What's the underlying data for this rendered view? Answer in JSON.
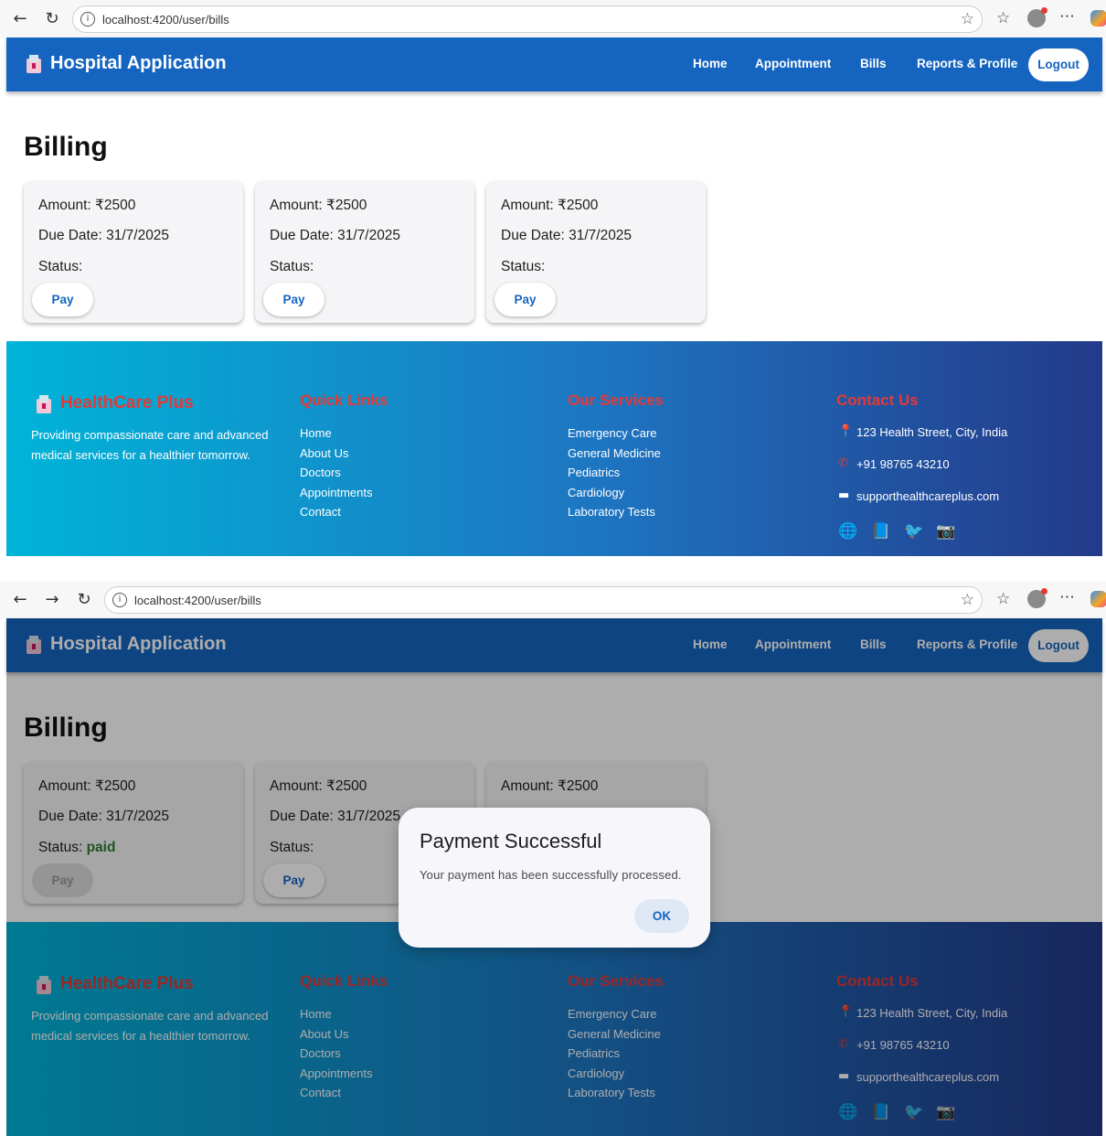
{
  "browser": {
    "url": "localhost:4200/user/bills",
    "icons": [
      "back-icon",
      "forward-icon",
      "refresh-icon",
      "info-icon",
      "star-icon",
      "favorites-icon",
      "profile-icon",
      "more-icon",
      "copilot-icon"
    ]
  },
  "header": {
    "title": "Hospital Application",
    "nav": [
      "Home",
      "Appointment",
      "Bills",
      "Reports & Profile"
    ],
    "logout": "Logout",
    "color": "#1565c0"
  },
  "billing": {
    "title": "Billing",
    "amount_label": "Amount: ₹2500",
    "due_label": "Due Date: 31/7/2025",
    "status_label": "Status:",
    "pay_label": "Pay",
    "paid_text": "paid"
  },
  "footer": {
    "brand": "HealthCare Plus",
    "description": "Providing compassionate care and advanced medical services for a healthier tomorrow.",
    "quick_links_title": "Quick Links",
    "quick_links": [
      "Home",
      "About Us",
      "Doctors",
      "Appointments",
      "Contact"
    ],
    "services_title": "Our Services",
    "services": [
      "Emergency Care",
      "General Medicine",
      "Pediatrics",
      "Cardiology",
      "Laboratory Tests"
    ],
    "contact_title": "Contact Us",
    "address": "123 Health Street, City, India",
    "phone": "+91 98765 43210",
    "email": "supporthealthcareplus.com",
    "social_icons": [
      "globe-icon",
      "book-icon",
      "bird-icon",
      "camera-icon"
    ]
  },
  "dialog": {
    "title": "Payment Successful",
    "message": "Your payment has been successfully processed.",
    "ok": "OK"
  }
}
